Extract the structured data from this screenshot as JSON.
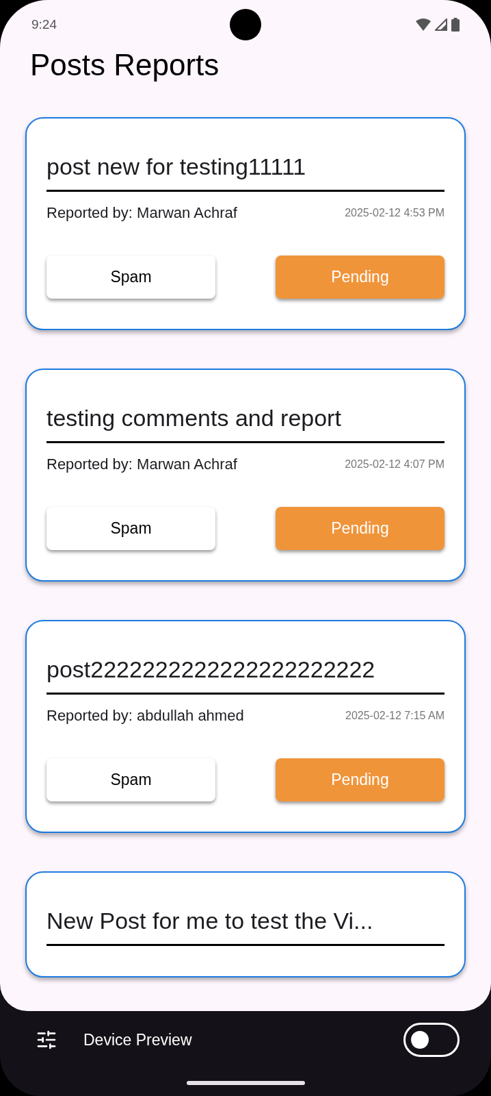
{
  "status_bar": {
    "time": "9:24"
  },
  "title": "Posts Reports",
  "reports": [
    {
      "title": "post new for testing11111",
      "reported_by": "Reported by: Marwan Achraf",
      "date": "2025-02-12 4:53 PM",
      "reason": "Spam",
      "status": "Pending"
    },
    {
      "title": "testing comments and report",
      "reported_by": "Reported by: Marwan Achraf",
      "date": "2025-02-12 4:07 PM",
      "reason": "Spam",
      "status": "Pending"
    },
    {
      "title": "post2222222222222222222222",
      "reported_by": "Reported by: abdullah ahmed",
      "date": "2025-02-12 7:15 AM",
      "reason": "Spam",
      "status": "Pending"
    },
    {
      "title": "New Post for me to test the Vi..."
    }
  ],
  "device_preview": {
    "label": "Device Preview",
    "on": false
  }
}
